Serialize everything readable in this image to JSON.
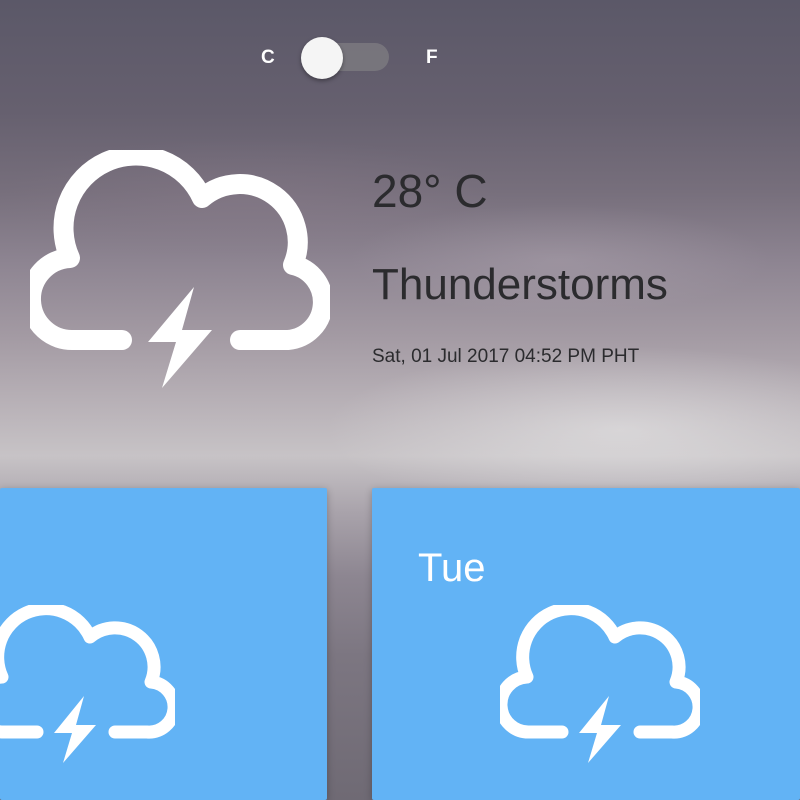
{
  "unit_toggle": {
    "left_label": "C",
    "right_label": "F",
    "selected": "C"
  },
  "current": {
    "temperature": "28° C",
    "condition": "Thunderstorms",
    "datetime": "Sat, 01 Jul 2017 04:52 PM PHT",
    "icon": "thunderstorm-cloud-icon"
  },
  "forecast": [
    {
      "day": "",
      "icon": "thunderstorm-cloud-icon"
    },
    {
      "day": "Tue",
      "icon": "thunderstorm-cloud-icon"
    }
  ],
  "colors": {
    "card_background": "#62b3f5",
    "icon_color": "#ffffff",
    "text_dark": "#2b2b2e"
  }
}
